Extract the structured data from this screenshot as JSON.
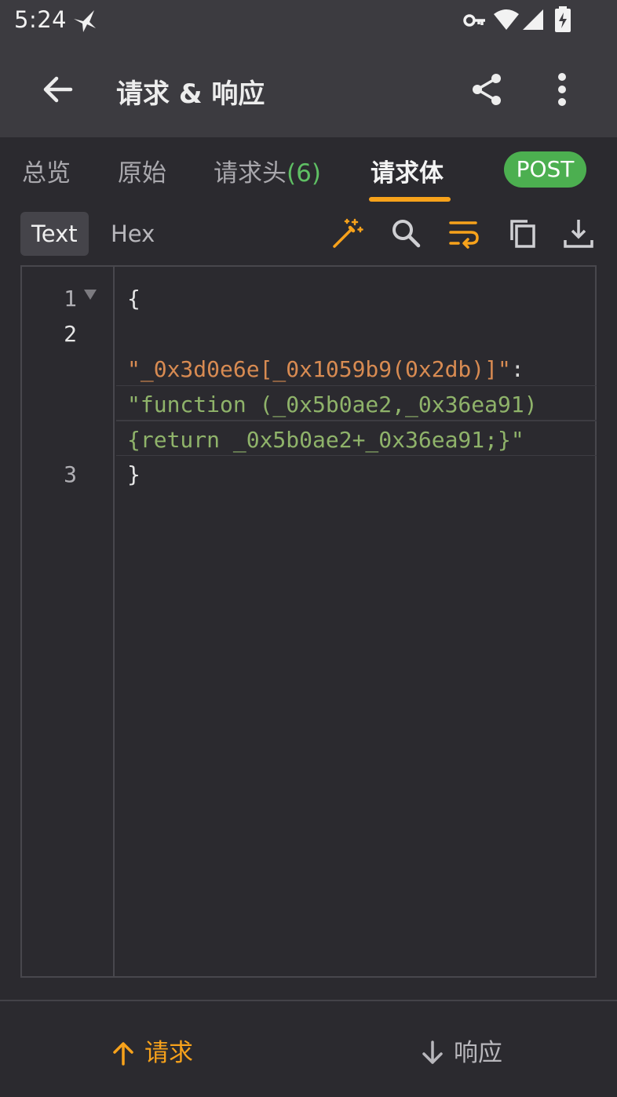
{
  "status_bar": {
    "time": "5:24",
    "icons": [
      "bird-icon",
      "vpn-key-icon",
      "wifi-icon",
      "cellular-icon",
      "battery-charging-icon"
    ]
  },
  "app_bar": {
    "title": "请求 & 响应",
    "icons": [
      "back-arrow-icon",
      "share-icon",
      "more-vert-icon"
    ]
  },
  "tabs": [
    {
      "label": "总览",
      "active": false
    },
    {
      "label": "原始",
      "active": false
    },
    {
      "label": "请求头",
      "count": "(6)",
      "active": false
    },
    {
      "label": "请求体",
      "active": true
    }
  ],
  "method_badge": "POST",
  "view_modes": {
    "text": "Text",
    "hex": "Hex",
    "selected": "Text"
  },
  "tools": [
    "format-magic-icon",
    "search-icon",
    "wrap-text-icon",
    "copy-icon",
    "download-icon"
  ],
  "editor": {
    "line_numbers": [
      "1",
      "2",
      "3"
    ],
    "lines": {
      "open_brace": "{",
      "key": "\"_0x3d0e6e[_0x1059b9(0x2db)]\"",
      "colon": ":",
      "value_part1": "\"function (_0x5b0ae2,_0x36ea91)",
      "value_part2": "{return _0x5b0ae2+_0x36ea91;}\"",
      "close_brace": "}"
    }
  },
  "bottom_nav": {
    "request": "请求",
    "response": "响应",
    "selected": "request"
  },
  "colors": {
    "accent": "#f7a21b",
    "post_badge": "#4caf50",
    "json_key": "#d88b52",
    "json_string": "#8fb36a",
    "count_green": "#5fbf64"
  }
}
